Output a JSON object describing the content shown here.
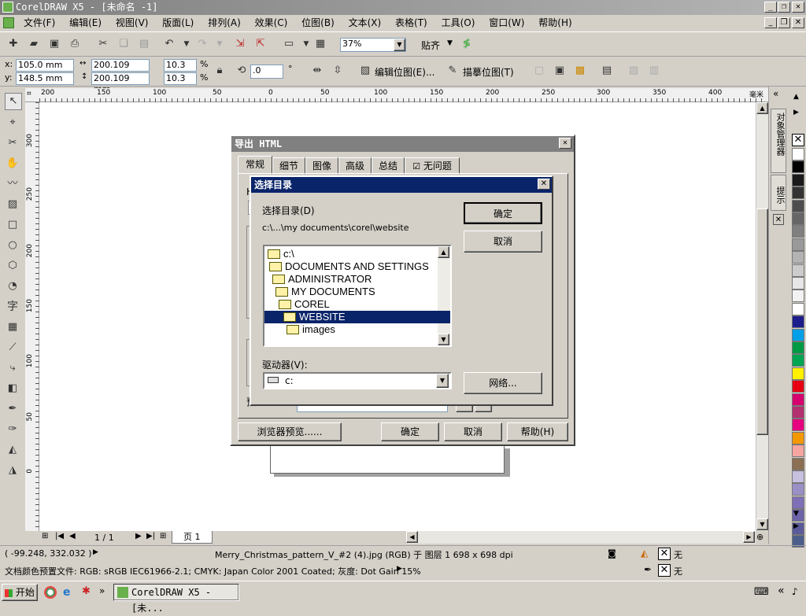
{
  "app": {
    "title": "CorelDRAW X5 - [未命名 -1]",
    "menu": [
      "文件(F)",
      "编辑(E)",
      "视图(V)",
      "版面(L)",
      "排列(A)",
      "效果(C)",
      "位图(B)",
      "文本(X)",
      "表格(T)",
      "工具(O)",
      "窗口(W)",
      "帮助(H)"
    ]
  },
  "toolbar": {
    "zoom": "37%",
    "snap": "贴齐"
  },
  "propbar": {
    "x_label": "x:",
    "x": "105.0 mm",
    "y_label": "y:",
    "y": "148.5 mm",
    "w": "200.109 mm",
    "h": "200.109 mm",
    "scale_w": "10.3",
    "scale_h": "10.3",
    "pct": "%",
    "angle": ".0",
    "deg": "°",
    "edit_bitmap": "编辑位图(E)...",
    "trace_bitmap": "描摹位图(T)"
  },
  "ruler": {
    "unit": "毫米",
    "h_ticks": [
      "200",
      "150",
      "100",
      "50",
      "0",
      "50",
      "100",
      "150",
      "200",
      "250",
      "300",
      "350",
      "400"
    ],
    "v_ticks": [
      "300",
      "250",
      "200",
      "150",
      "100",
      "50",
      "0"
    ]
  },
  "dockers": {
    "object_manager": "对象管理器",
    "hints": "提示"
  },
  "palette": [
    "#ffffff",
    "#000000",
    "#1a1a1a",
    "#333333",
    "#4d4d4d",
    "#666666",
    "#808080",
    "#999999",
    "#b3b3b3",
    "#cccccc",
    "#e6e6e6",
    "#f2f2f2",
    "#ffffff",
    "#1d1d8c",
    "#00a0e9",
    "#009944",
    "#00a651",
    "#fff100",
    "#e60012",
    "#d6006f",
    "#b3306f",
    "#e4007f",
    "#f39800",
    "#f6a5a0",
    "#8c6e52",
    "#c8c0df",
    "#9a90c6",
    "#7f6fb6",
    "#6c63a8",
    "#5a5a9a",
    "#4b5d8a"
  ],
  "export_dialog": {
    "title": "导出 HTML",
    "tabs": [
      "常规",
      "细节",
      "图像",
      "高级",
      "总结",
      "无问题"
    ],
    "partial_h": "H",
    "partial_prefix": "预",
    "buttons": {
      "preview": "浏览器预览......",
      "ok": "确定",
      "cancel": "取消",
      "help": "帮助(H)"
    }
  },
  "dir_dialog": {
    "title": "选择目录",
    "dir_label": "选择目录(D)",
    "path": "c:\\...\\my documents\\corel\\website",
    "tree": [
      "c:\\",
      "DOCUMENTS AND SETTINGS",
      "ADMINISTRATOR",
      "MY DOCUMENTS",
      "COREL",
      "WEBSITE",
      "images"
    ],
    "selected_index": 5,
    "drive_label": "驱动器(V):",
    "drive": "c:",
    "ok": "确定",
    "cancel": "取消",
    "network": "网络..."
  },
  "pager": {
    "page_count": "1 / 1",
    "page_tab": "页 1"
  },
  "status": {
    "coords": "( -99.248, 332.032 )",
    "object_info": "Merry_Christmas_pattern_V_#2 (4).jpg (RGB) 于 图层 1 698 x 698 dpi",
    "color_profile": "文档颜色预置文件: RGB: sRGB IEC61966-2.1; CMYK: Japan Color 2001 Coated; 灰度: Dot Gain 15%",
    "fill_none": "无",
    "outline_none": "无"
  },
  "taskbar": {
    "start": "开始",
    "task": "CorelDRAW X5 - [未..."
  }
}
